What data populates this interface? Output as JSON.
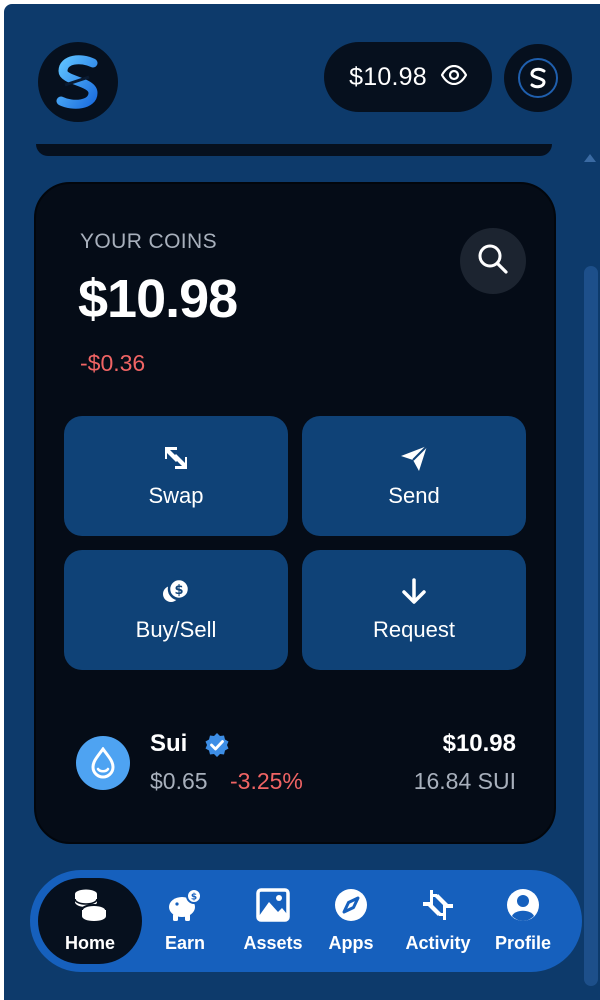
{
  "header": {
    "balance": "$10.98",
    "logo_icon": "sui-wallet-logo-icon",
    "visibility_icon": "eye-icon",
    "account_icon": "account-logo-icon"
  },
  "coins_card": {
    "label": "YOUR COINS",
    "total": "$10.98",
    "change": "-$0.36",
    "search_icon": "search-icon"
  },
  "actions": [
    {
      "label": "Swap",
      "icon": "swap-icon"
    },
    {
      "label": "Send",
      "icon": "paper-plane-icon"
    },
    {
      "label": "Buy/Sell",
      "icon": "coins-icon"
    },
    {
      "label": "Request",
      "icon": "arrow-down-icon"
    }
  ],
  "coins": [
    {
      "name": "Sui",
      "price": "$0.65",
      "change": "-3.25%",
      "value": "$10.98",
      "amount": "16.84 SUI",
      "verified": true
    }
  ],
  "nav": [
    {
      "label": "Home",
      "icon": "home-coins-icon",
      "active": true
    },
    {
      "label": "Earn",
      "icon": "piggy-bank-icon",
      "active": false
    },
    {
      "label": "Assets",
      "icon": "image-icon",
      "active": false
    },
    {
      "label": "Apps",
      "icon": "compass-icon",
      "active": false
    },
    {
      "label": "Activity",
      "icon": "activity-arrows-icon",
      "active": false
    },
    {
      "label": "Profile",
      "icon": "user-circle-icon",
      "active": false
    }
  ],
  "colors": {
    "background": "#0d3a6b",
    "card": "#050c17",
    "action": "#0f4277",
    "nav": "#1660bd",
    "negative": "#f06464",
    "sui_blue": "#4ea3f2"
  }
}
